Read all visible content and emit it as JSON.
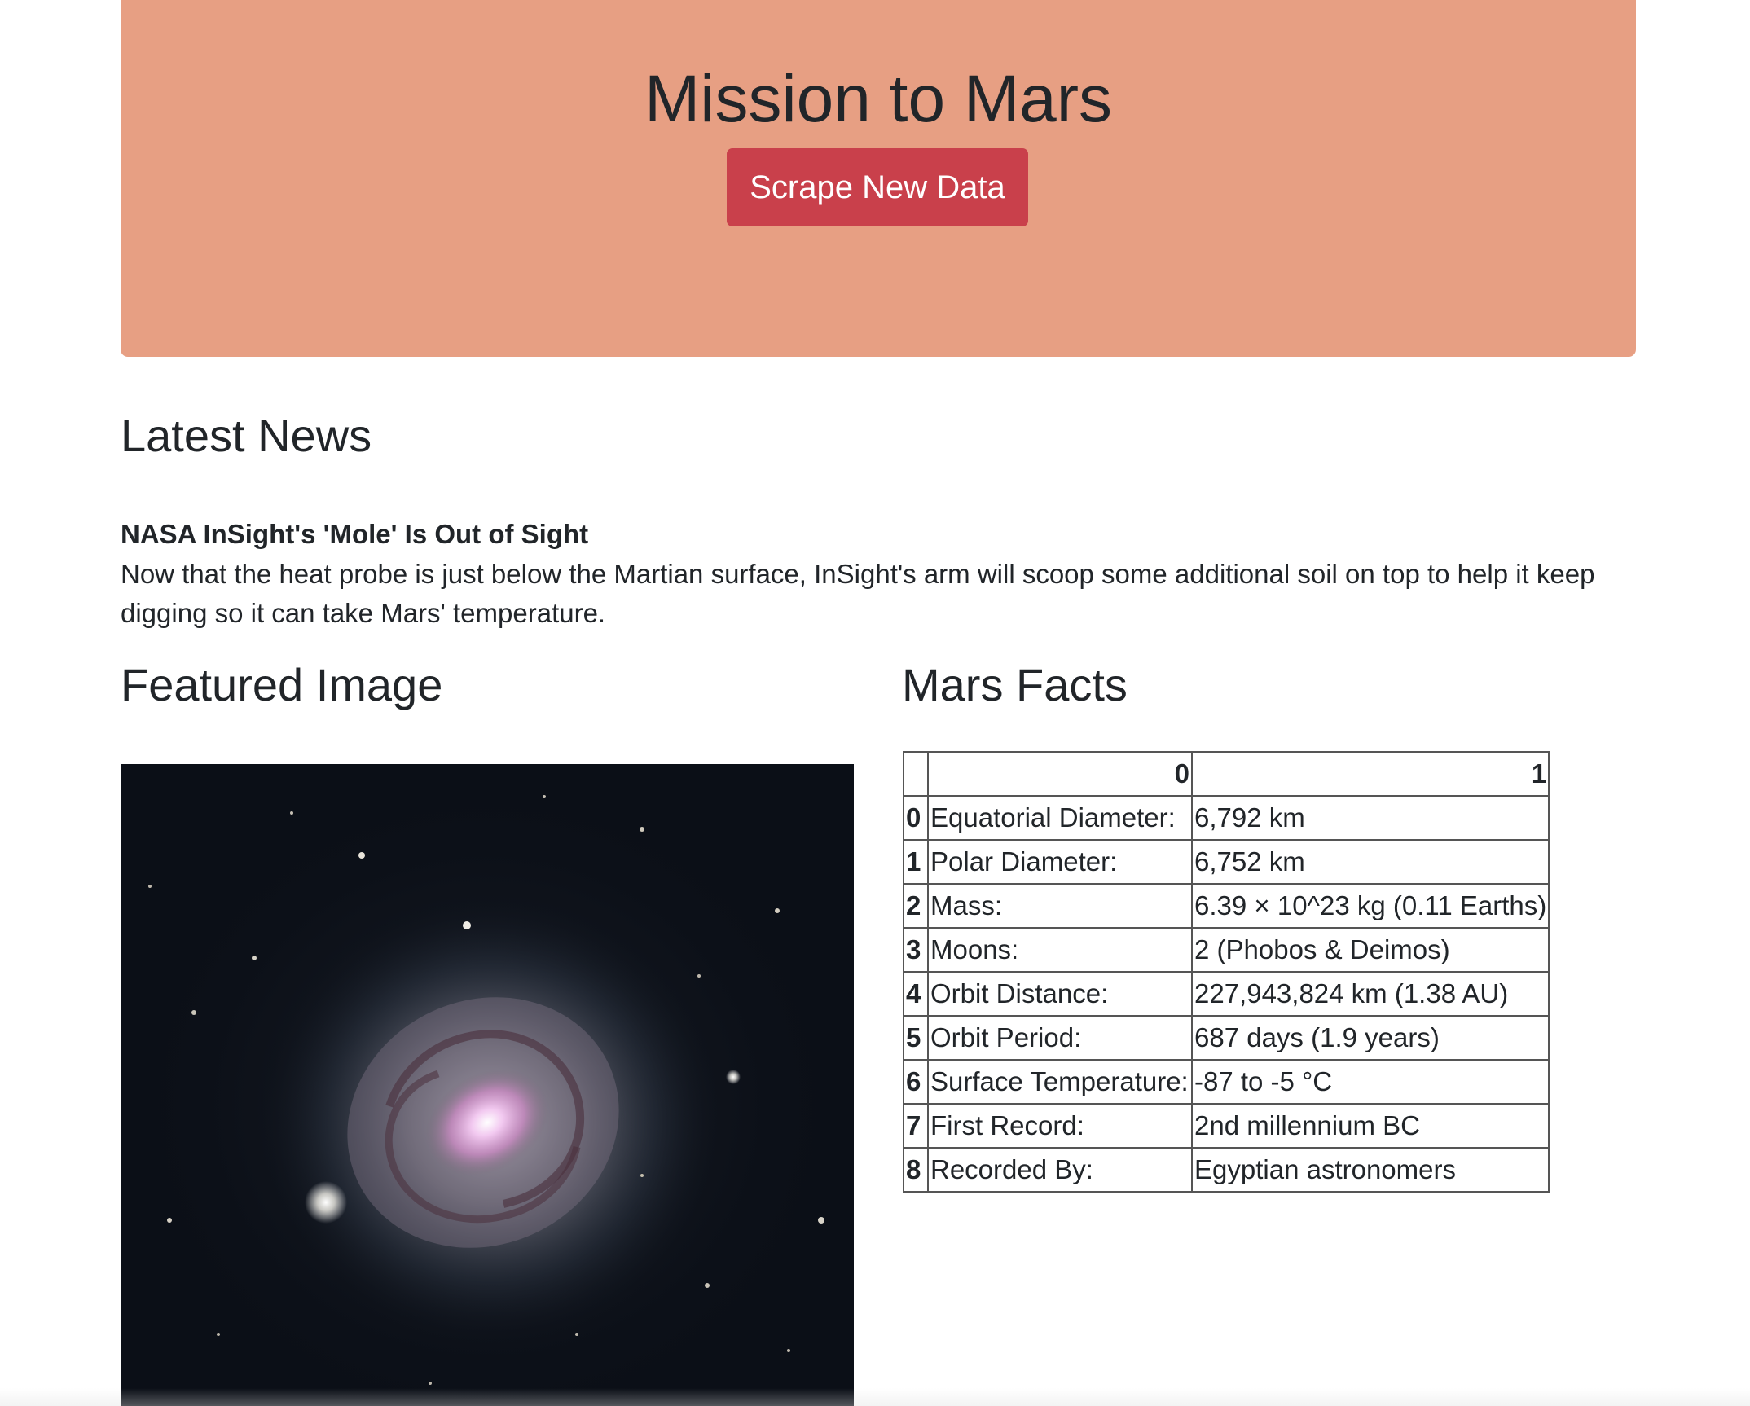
{
  "jumbotron": {
    "title": "Mission to Mars",
    "button_label": "Scrape New Data",
    "background_color": "#e79f83",
    "button_color": "#c9404b"
  },
  "news": {
    "heading": "Latest News",
    "title": "NASA InSight's 'Mole' Is Out of Sight",
    "paragraph": "Now that the heat probe is just below the Martian surface, InSight's arm will scoop some additional soil on top to help it keep digging so it can take Mars' temperature."
  },
  "featured": {
    "heading": "Featured Image",
    "image_subject": "spiral galaxy"
  },
  "facts": {
    "heading": "Mars Facts",
    "columns": [
      "",
      "0",
      "1"
    ],
    "rows": [
      {
        "index": "0",
        "label": "Equatorial Diameter:",
        "value": "6,792 km"
      },
      {
        "index": "1",
        "label": "Polar Diameter:",
        "value": "6,752 km"
      },
      {
        "index": "2",
        "label": "Mass:",
        "value": "6.39 × 10^23 kg (0.11 Earths)"
      },
      {
        "index": "3",
        "label": "Moons:",
        "value": "2 (Phobos & Deimos)"
      },
      {
        "index": "4",
        "label": "Orbit Distance:",
        "value": "227,943,824 km (1.38 AU)"
      },
      {
        "index": "5",
        "label": "Orbit Period:",
        "value": "687 days (1.9 years)"
      },
      {
        "index": "6",
        "label": "Surface Temperature:",
        "value": "-87 to -5 °C"
      },
      {
        "index": "7",
        "label": "First Record:",
        "value": "2nd millennium BC"
      },
      {
        "index": "8",
        "label": "Recorded By:",
        "value": "Egyptian astronomers"
      }
    ]
  }
}
